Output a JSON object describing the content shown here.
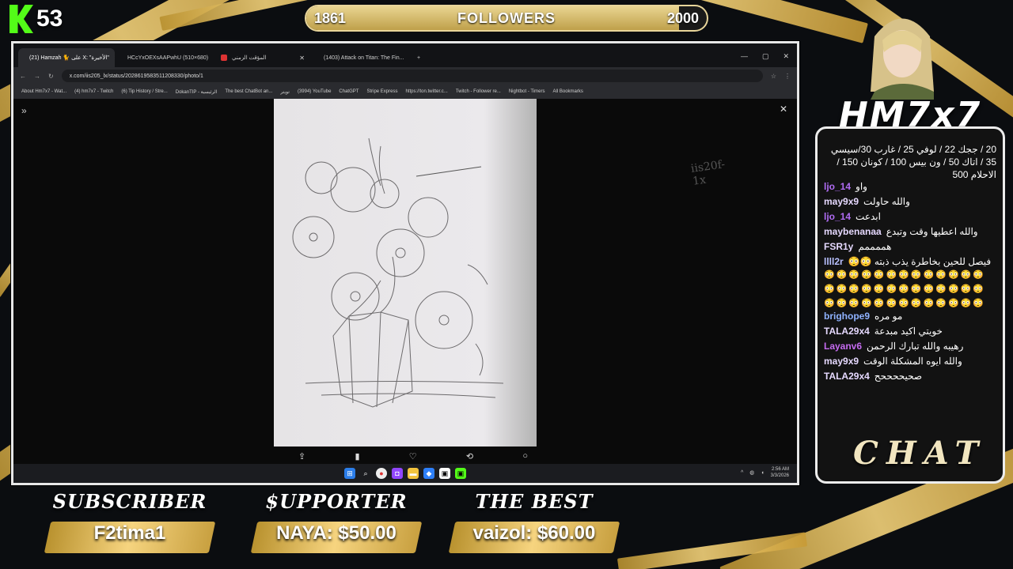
{
  "kick": {
    "count": "53"
  },
  "followers": {
    "current": "1861",
    "label": "FOLLOWERS",
    "goal": "2000",
    "progress": 0.93
  },
  "browser": {
    "tabs": [
      {
        "title": "(21) Hamzah 🐈 على X: \"الأخيرة\"",
        "active": true
      },
      {
        "title": "HCcYxOEXsAAPwhU (510×680)"
      },
      {
        "title": "المؤقت الزمني"
      },
      {
        "title": "(1403) Attack on Titan: The Fin..."
      }
    ],
    "url": "x.com/iis205_lx/status/2028619583511208330/photo/1",
    "bookmarks": [
      "About Hm7x7 - Wat...",
      "(4) hm7x7 - Twitch",
      "(6) Tip History / Stre...",
      "DokanTIP - الرئيسية",
      "The best ChatBot an...",
      "تويتر",
      "(3994) YouTube",
      "ChatGPT",
      "Stripe Express",
      "https://ton.twitter.c...",
      "Twitch - Follower re...",
      "Nightbot - Timers",
      "All Bookmarks"
    ],
    "photo_caption": "iis20f-1x",
    "clock": {
      "time": "2:56 AM",
      "date": "3/3/2026"
    }
  },
  "logo": {
    "text": "HM7x7"
  },
  "chat": {
    "title": "CHAT",
    "pinned": "20 / ججك 22 / لوفي 25 / غارب 30/سيسي 35 / اتاك 50 / ون بيس 100 / كونان 150 / الاحلام 500",
    "messages": [
      {
        "user": "ljo_14",
        "color": "#b06cf3",
        "text": "واو"
      },
      {
        "user": "may9x9",
        "color": "#e6d9ff",
        "text": "والله حاولت"
      },
      {
        "user": "ljo_14",
        "color": "#b06cf3",
        "text": "ابدعت"
      },
      {
        "user": "maybenanaa",
        "color": "#e6d9ff",
        "text": "والله اعطيها وقت وتبدع"
      },
      {
        "user": "FSR1y",
        "color": "#e6d9ff",
        "text": "هممممم"
      },
      {
        "user": "llll2r",
        "color": "#b8c0ff",
        "text": "فيصل للحين بخاطرة يذب ذبته 😳😳"
      }
    ],
    "emoji_row": "😳😳😳😳😳😳😳😳😳😳😳😳😳😳😳😳😳😳😳😳😳😳😳😳😳😳😳😳😳😳😳😳😳😳😳😳😳😳😳",
    "messages2": [
      {
        "user": "brighope9",
        "color": "#8fb2ff",
        "text": "مو مره"
      },
      {
        "user": "TALA29x4",
        "color": "#e6d9ff",
        "text": "خويتي اكيد مبدعة"
      },
      {
        "user": "Layanv6",
        "color": "#c56bf0",
        "text": "رهيبه والله تبارك الرحمن"
      },
      {
        "user": "may9x9",
        "color": "#e6d9ff",
        "text": "والله ايوه المشكلة الوقت"
      },
      {
        "user": "TALA29x4",
        "color": "#e6d9ff",
        "text": "صحيححححح"
      }
    ]
  },
  "banners": [
    {
      "label": "SUBSCRIBER",
      "value": "F2tima1"
    },
    {
      "label": "$UPPORTER",
      "value": "NAYA: $50.00"
    },
    {
      "label": "THE BEST",
      "value": "vaizol: $60.00"
    }
  ]
}
